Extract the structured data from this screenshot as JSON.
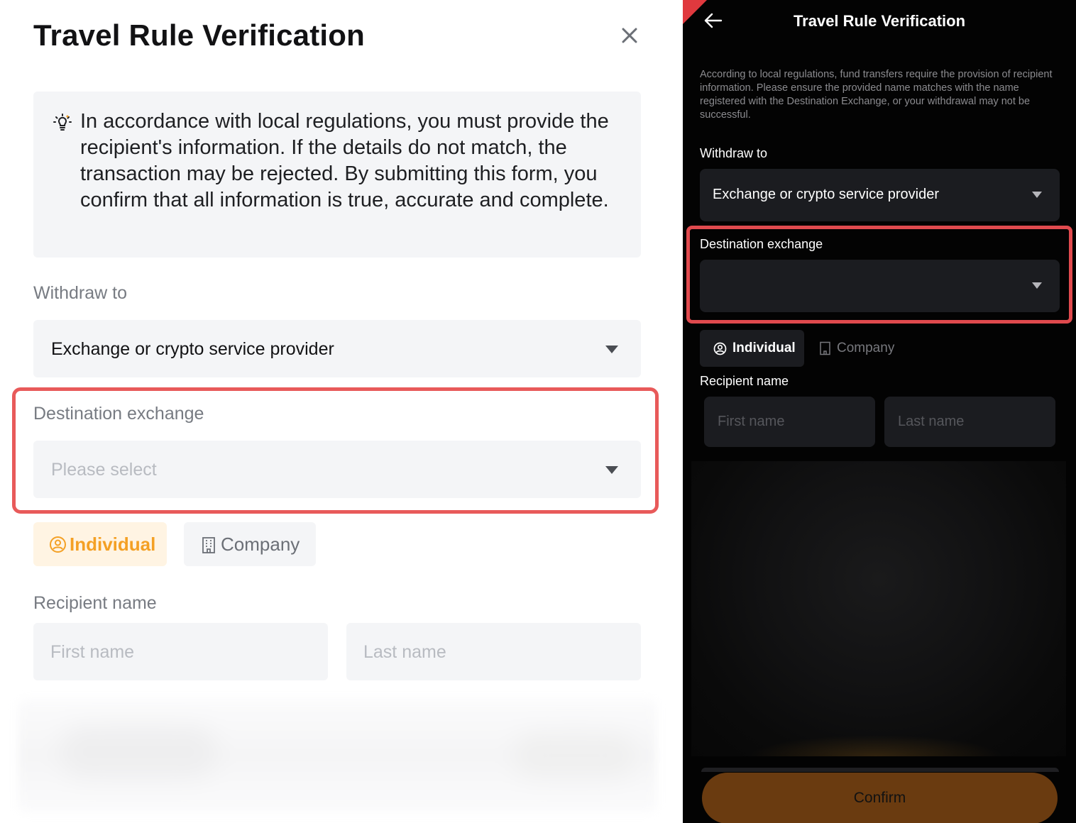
{
  "light_panel": {
    "title": "Travel Rule Verification",
    "notice_text": "In accordance with local regulations, you must provide the recipient's information. If the details do not match, the transaction may be rejected. By submitting this form, you confirm that all information is true, accurate and complete.",
    "withdraw_to_label": "Withdraw to",
    "withdraw_to_value": "Exchange or crypto service provider",
    "destination_label": "Destination exchange",
    "destination_placeholder": "Please select",
    "tab_individual": "Individual",
    "tab_company": "Company",
    "recipient_label": "Recipient name",
    "first_name_placeholder": "First name",
    "last_name_placeholder": "Last name",
    "accent_color": "#f4a024",
    "highlight_color": "#e85a5a"
  },
  "dark_panel": {
    "title": "Travel Rule Verification",
    "description": "According to local regulations, fund transfers require the provision of recipient information. Please ensure the provided name matches with the name registered with the Destination Exchange, or your withdrawal may not be successful.",
    "withdraw_to_label": "Withdraw to",
    "withdraw_to_value": "Exchange or crypto service provider",
    "destination_label": "Destination exchange",
    "destination_value": "",
    "tab_individual": "Individual",
    "tab_company": "Company",
    "recipient_label": "Recipient name",
    "first_name_placeholder": "First name",
    "last_name_placeholder": "Last name",
    "confirm_label": "Confirm",
    "confirm_color": "#6a3b10",
    "highlight_color": "#e04a4e"
  },
  "icons": {
    "close": "close-icon",
    "bulb": "lightbulb-icon",
    "individual": "user-circle-icon",
    "company": "building-icon",
    "back": "arrow-left-icon",
    "dropdown": "caret-down-icon"
  }
}
